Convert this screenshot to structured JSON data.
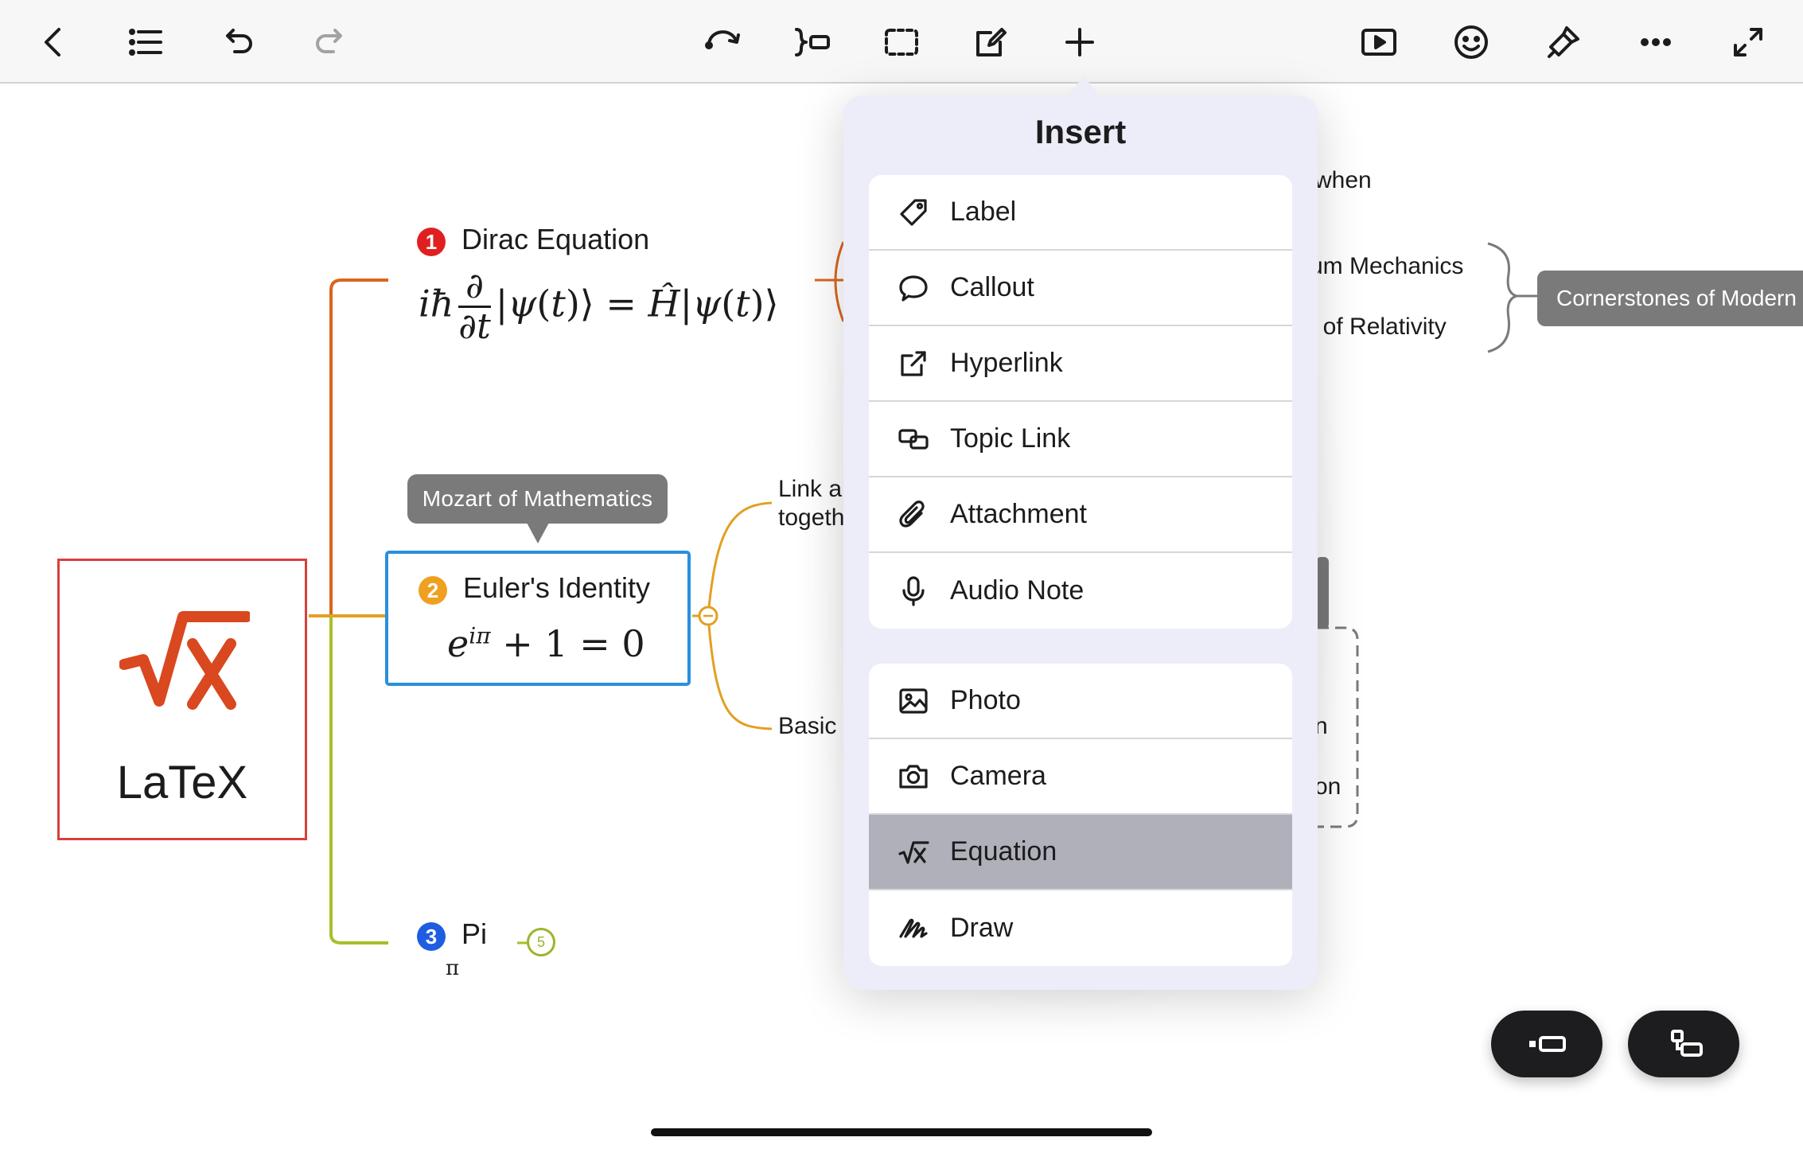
{
  "toolbar": {
    "left": [
      {
        "name": "back-icon"
      },
      {
        "name": "outline-list-icon"
      },
      {
        "name": "undo-icon"
      },
      {
        "name": "redo-icon"
      }
    ],
    "center": [
      {
        "name": "relationship-icon"
      },
      {
        "name": "summary-icon"
      },
      {
        "name": "boundary-icon"
      },
      {
        "name": "edit-note-icon"
      },
      {
        "name": "plus-icon"
      }
    ],
    "right": [
      {
        "name": "presentation-play-icon"
      },
      {
        "name": "sticker-smiley-icon"
      },
      {
        "name": "format-brush-icon"
      },
      {
        "name": "more-icon"
      },
      {
        "name": "expand-icon"
      }
    ]
  },
  "map": {
    "root_label": "LaTeX",
    "topics": [
      {
        "number": "1",
        "title": "Dirac Equation",
        "color": "#e02020"
      },
      {
        "number": "2",
        "title": "Euler's Identity",
        "color": "#f0a020"
      },
      {
        "number": "3",
        "title": "Pi",
        "color": "#1f5de0"
      }
    ],
    "callout_text": "Mozart of Mathematics",
    "pi_symbol": "π",
    "collapsed_count": "5",
    "subtopics": {
      "link_line1": "Link a",
      "link_line2": "togeth",
      "basic": "Basic",
      "when": "when",
      "quantum": "um Mechanics",
      "relativity": "/ of Relativity",
      "partial_n": "n",
      "partial_on": "on"
    },
    "summary_text": "Cornerstones of Modern"
  },
  "insert_menu": {
    "title": "Insert",
    "group1": [
      {
        "label": "Label",
        "icon": "tag-icon"
      },
      {
        "label": "Callout",
        "icon": "speech-bubble-icon"
      },
      {
        "label": "Hyperlink",
        "icon": "external-link-icon"
      },
      {
        "label": "Topic Link",
        "icon": "topic-link-icon"
      },
      {
        "label": "Attachment",
        "icon": "paperclip-icon"
      },
      {
        "label": "Audio Note",
        "icon": "microphone-icon"
      }
    ],
    "group2": [
      {
        "label": "Photo",
        "icon": "photo-icon"
      },
      {
        "label": "Camera",
        "icon": "camera-icon"
      },
      {
        "label": "Equation",
        "icon": "square-root-icon",
        "selected": true
      },
      {
        "label": "Draw",
        "icon": "draw-scribble-icon"
      }
    ]
  },
  "colors": {
    "accent_orange": "#d9651f",
    "branch_gold": "#e2a020",
    "branch_green": "#a8bf2a",
    "selection_blue": "#2a90de",
    "root_border": "#d7403d"
  }
}
